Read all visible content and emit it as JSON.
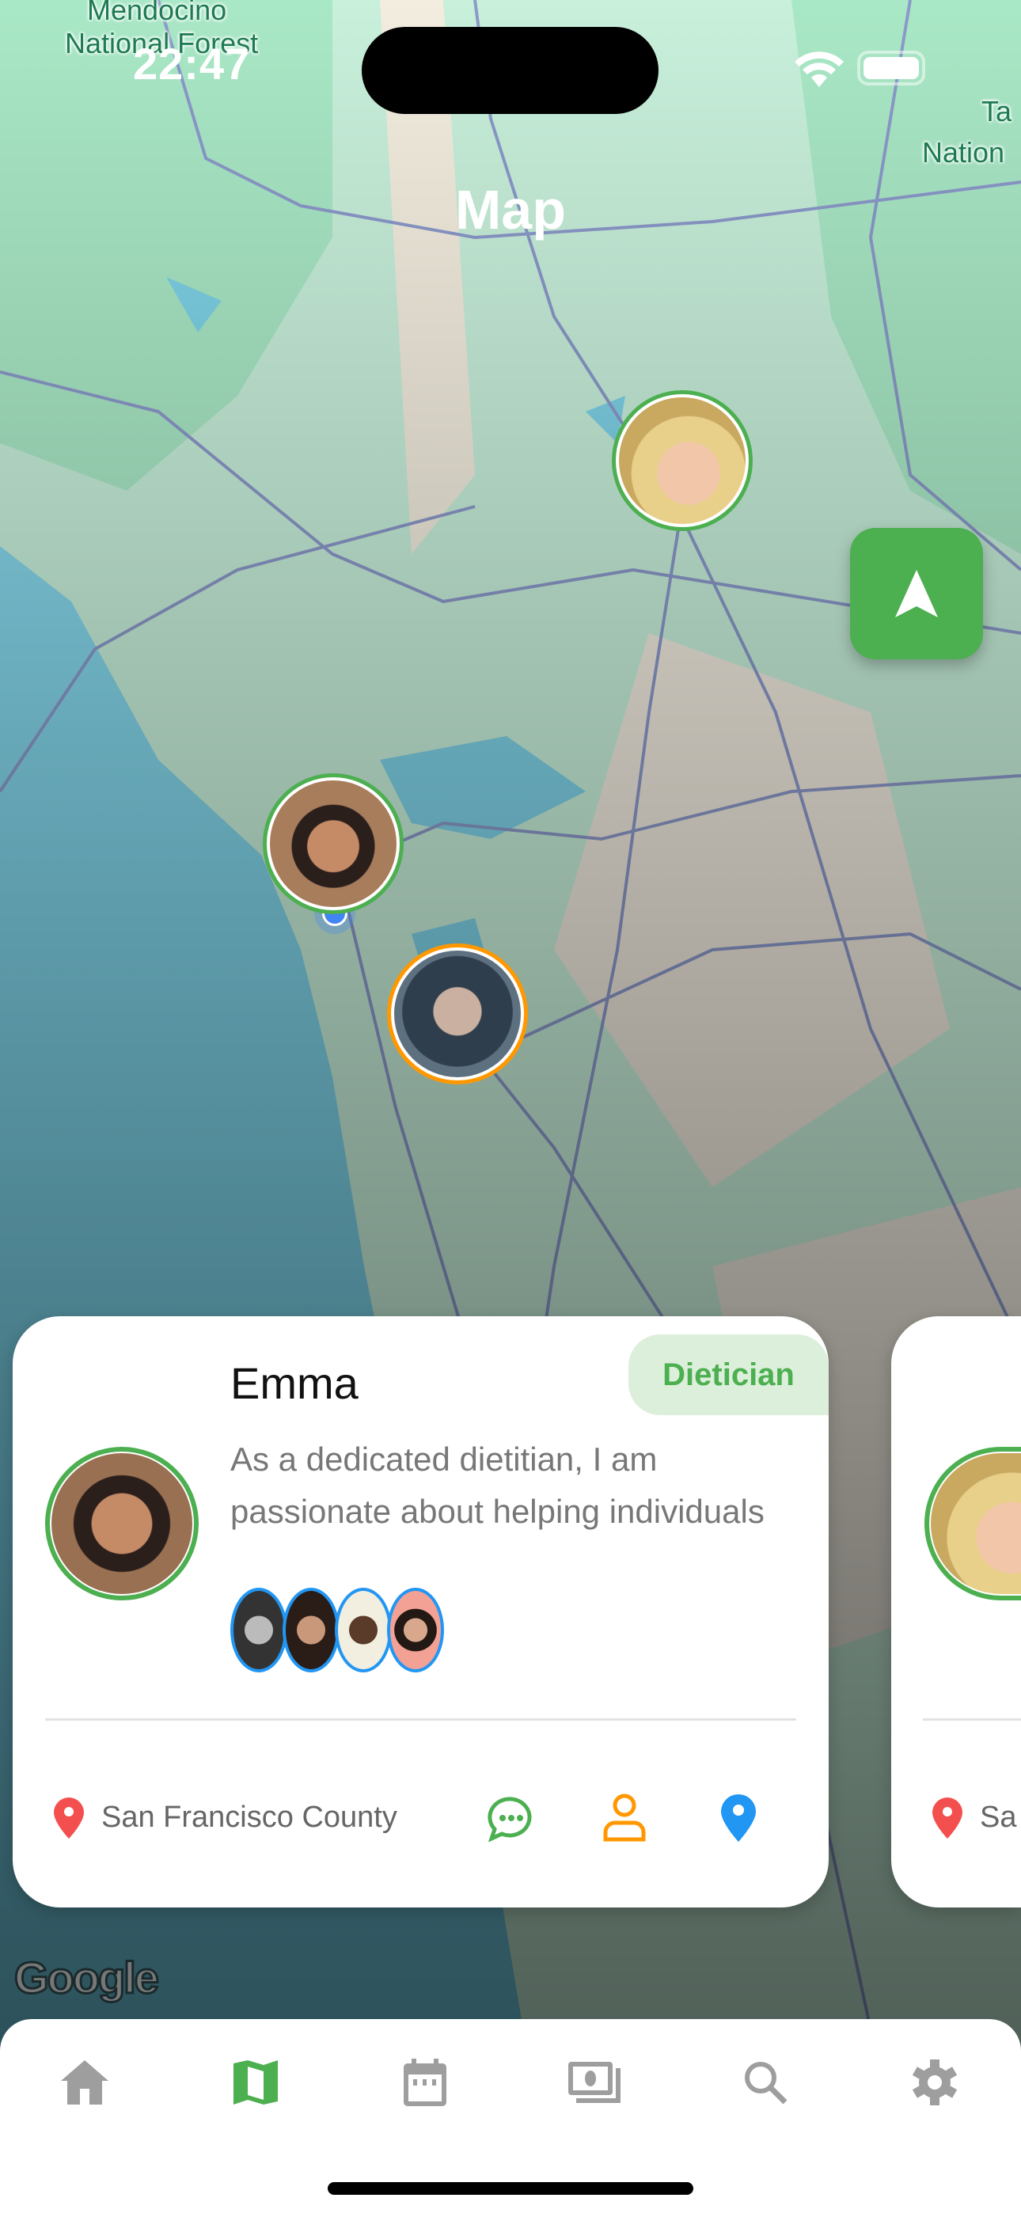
{
  "status_bar": {
    "time": "22:47"
  },
  "header": {
    "title": "Map"
  },
  "map": {
    "labels": [
      {
        "text": "Mendocino"
      },
      {
        "text": "National Forest"
      },
      {
        "text": "Ta"
      },
      {
        "text": "Nation"
      }
    ],
    "attribution": "Google",
    "colors": {
      "land": "#c8f0db",
      "forest": "#a8e6c4",
      "water": "#7fd3e8",
      "road": "#8c9acb"
    },
    "markers": [
      {
        "name": "marker-1",
        "ring": "#4caf50"
      },
      {
        "name": "marker-emma",
        "ring": "#4caf50"
      },
      {
        "name": "marker-3",
        "ring": "#ff9800"
      }
    ]
  },
  "locate_button": {
    "icon": "navigation-arrow-icon",
    "color": "#4caf50"
  },
  "cards": [
    {
      "name": "Emma",
      "role": "Dietician",
      "description_lines": [
        "As a dedicated dietitian, I am",
        "passionate about helping individuals"
      ],
      "location": "San Francisco County",
      "clients_count": 4
    },
    {
      "location": "Sa"
    }
  ],
  "nav": {
    "items": [
      {
        "icon": "home-icon"
      },
      {
        "icon": "map-icon",
        "active": true
      },
      {
        "icon": "calendar-icon"
      },
      {
        "icon": "photos-icon"
      },
      {
        "icon": "search-icon"
      },
      {
        "icon": "settings-icon"
      }
    ],
    "active_color": "#4caf50",
    "inactive_color": "#9e9e9e"
  }
}
